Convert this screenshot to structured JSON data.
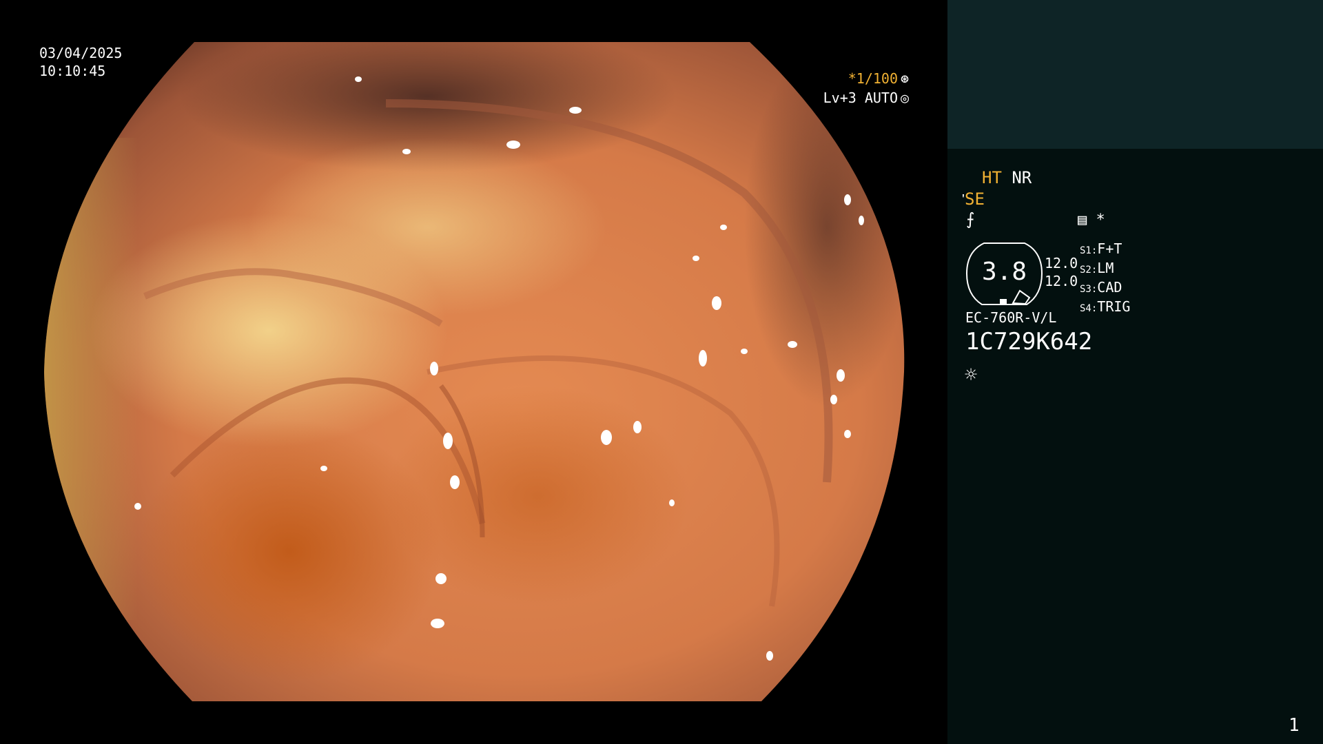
{
  "overlay": {
    "date": "03/04/2025",
    "time": "10:10:45",
    "shutter_prefix": "*",
    "shutter": "1/100",
    "level": "Lv+3",
    "mode": "AUTO",
    "shutter_icon": "shutter-icon",
    "auto_icon": "iris-icon"
  },
  "panel": {
    "ht": "HT",
    "nr": "NR",
    "se": "SE",
    "se_icon": "structure-enhance-icon",
    "color_icon": "color-mode-icon",
    "record_icon": "record-icon",
    "asterisk": "*",
    "gauge_value": "3.8",
    "level_1": "12.0",
    "level_2": "12.0",
    "switches": [
      {
        "key": "S1:",
        "value": "F+T"
      },
      {
        "key": "S2:",
        "value": "LM"
      },
      {
        "key": "S3:",
        "value": "CAD"
      },
      {
        "key": "S4:",
        "value": "TRIG"
      }
    ],
    "model": "EC-760R-V/L",
    "serial": "1C729K642",
    "light_icon": "light-icon",
    "page_number": "1"
  },
  "colors": {
    "accent": "#f2b233",
    "panel_bg": "#03100f",
    "panel_top": "#0e2426",
    "text": "#ffffff"
  }
}
